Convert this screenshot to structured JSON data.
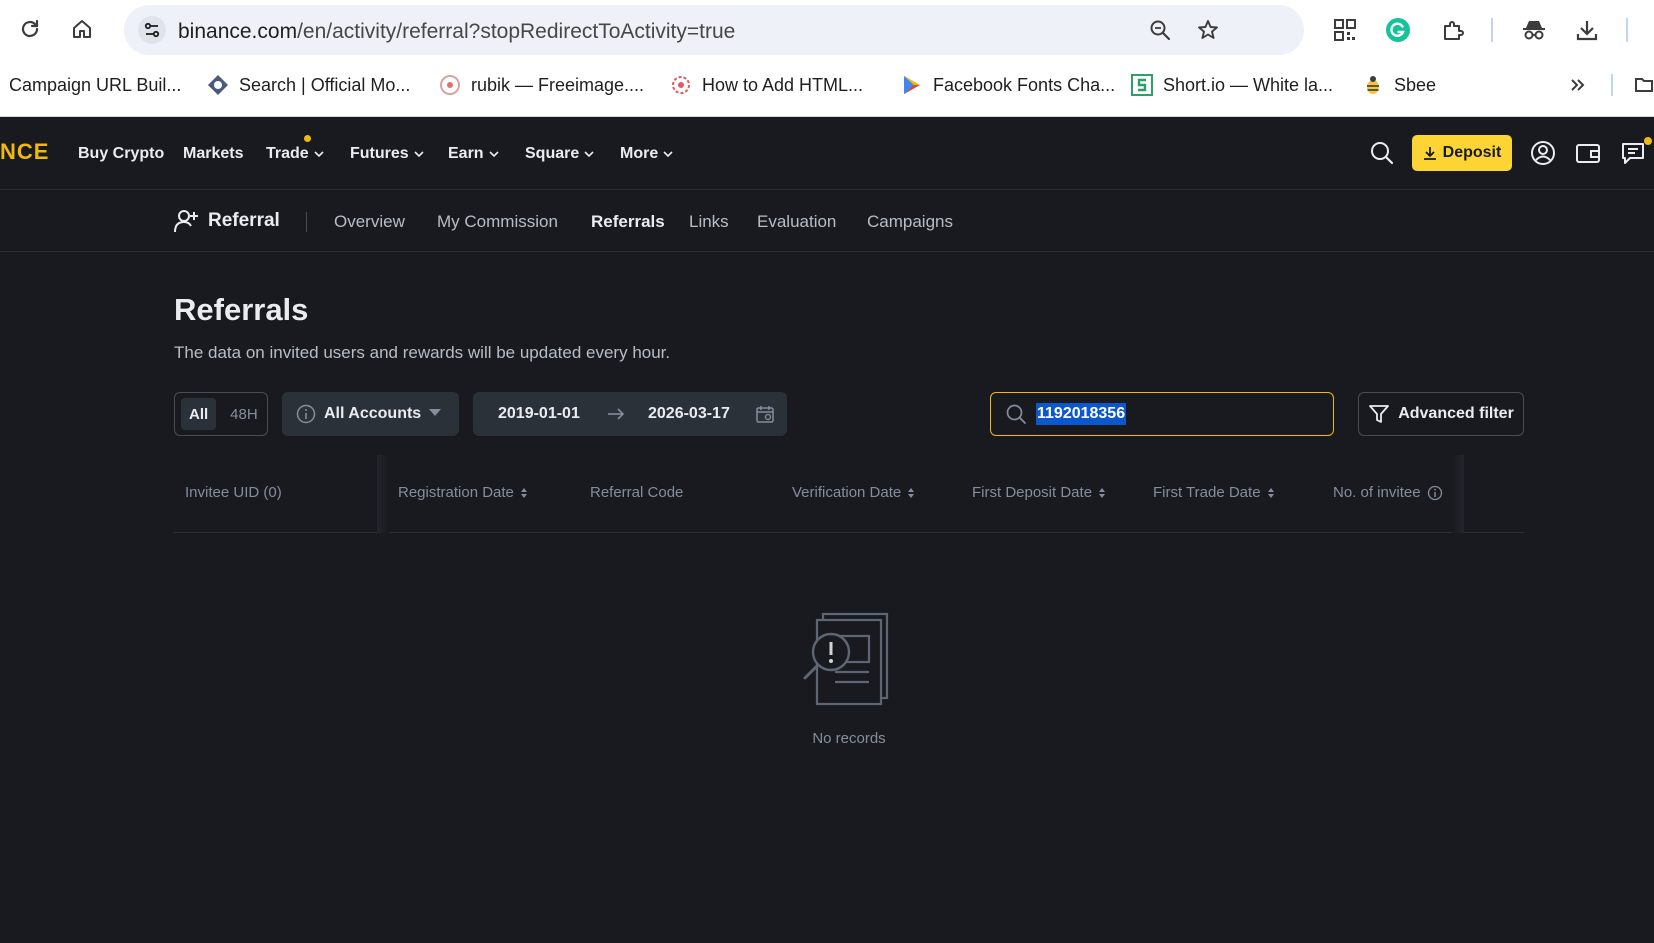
{
  "browser": {
    "url_host": "binance.com",
    "url_path": "/en/activity/referral?stopRedirectToActivity=true",
    "bookmarks": [
      "Campaign URL Buil...",
      "Search | Official Mo...",
      "rubik — Freeimage....",
      "How to Add HTML...",
      "Facebook Fonts Cha...",
      "Short.io — White la...",
      "Sbee"
    ]
  },
  "header": {
    "logo": "NCE",
    "nav": [
      "Buy Crypto",
      "Markets",
      "Trade",
      "Futures",
      "Earn",
      "Square",
      "More"
    ],
    "deposit_label": "Deposit"
  },
  "subnav": {
    "brand": "Referral",
    "items": [
      "Overview",
      "My Commission",
      "Referrals",
      "Links",
      "Evaluation",
      "Campaigns"
    ],
    "active": "Referrals"
  },
  "main": {
    "title": "Referrals",
    "description": "The data on invited users and rewards will be updated every hour.",
    "time_options": [
      "All",
      "48H"
    ],
    "accounts_select": "All Accounts",
    "date_from": "2019-01-01",
    "date_to": "2026-03-17",
    "search_value": "1192018356",
    "advanced_filter": "Advanced filter"
  },
  "table": {
    "columns": [
      "Invitee UID (0)",
      "Registration Date",
      "Referral Code",
      "Verification Date",
      "First Deposit Date",
      "First Trade Date",
      "No. of invitee"
    ],
    "empty_text": "No records"
  },
  "colors": {
    "accent": "#f0b90b",
    "deposit_bg": "#fcd535",
    "page_bg": "#181a20",
    "panel_bg": "#2b3139"
  }
}
